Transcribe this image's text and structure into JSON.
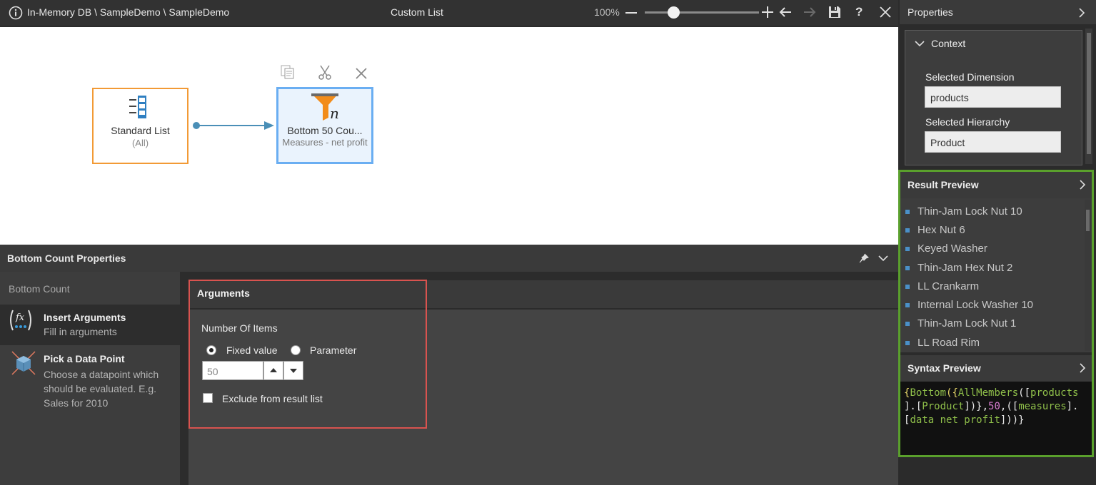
{
  "topbar": {
    "breadcrumb": "In-Memory DB \\ SampleDemo \\ SampleDemo",
    "title": "Custom List",
    "zoom": "100%",
    "zoom_slider_value": 0.25
  },
  "canvas": {
    "node_source": {
      "title": "Standard List",
      "subtitle": "(All)"
    },
    "node_filter": {
      "title": "Bottom 50 Cou...",
      "subtitle": "Measures - net profit",
      "icon_letter": "n"
    }
  },
  "bottom_panel": {
    "title": "Bottom Count Properties",
    "section_label": "Bottom Count",
    "items": [
      {
        "title": "Insert Arguments",
        "description": "Fill in arguments"
      },
      {
        "title": "Pick a Data Point",
        "description": "Choose a datapoint which should be evaluated. E.g. Sales for 2010"
      }
    ],
    "arguments": {
      "header": "Arguments",
      "number_label": "Number Of Items",
      "option_fixed": "Fixed value",
      "option_parameter": "Parameter",
      "selected_option": "Fixed value",
      "value": "50",
      "exclude_label": "Exclude from result list",
      "exclude_checked": false
    }
  },
  "properties": {
    "title": "Properties",
    "context": {
      "header": "Context",
      "dimension_label": "Selected Dimension",
      "dimension_value": "products",
      "hierarchy_label": "Selected Hierarchy",
      "hierarchy_value": "Product"
    }
  },
  "result_preview": {
    "title": "Result Preview",
    "items": [
      "Thin-Jam Lock Nut 10",
      "Hex Nut 6",
      "Keyed Washer",
      "Thin-Jam Hex Nut 2",
      "LL Crankarm",
      "Internal Lock Washer 10",
      "Thin-Jam Lock Nut 1",
      "LL Road Rim"
    ]
  },
  "syntax_preview": {
    "title": "Syntax Preview",
    "line1": [
      "{",
      "Bottom",
      "({",
      "AllMembers",
      "([",
      "products"
    ],
    "line2": [
      "].[",
      "Product",
      "])},",
      "50",
      ",([",
      "measures",
      "]."
    ],
    "line3": [
      "[",
      "data net profit",
      "]))}"
    ]
  },
  "colors": {
    "accent_blue": "#6aaef2",
    "source_orange": "#f29a35",
    "highlight_red": "#d9534f",
    "highlight_green": "#5aa02c"
  }
}
